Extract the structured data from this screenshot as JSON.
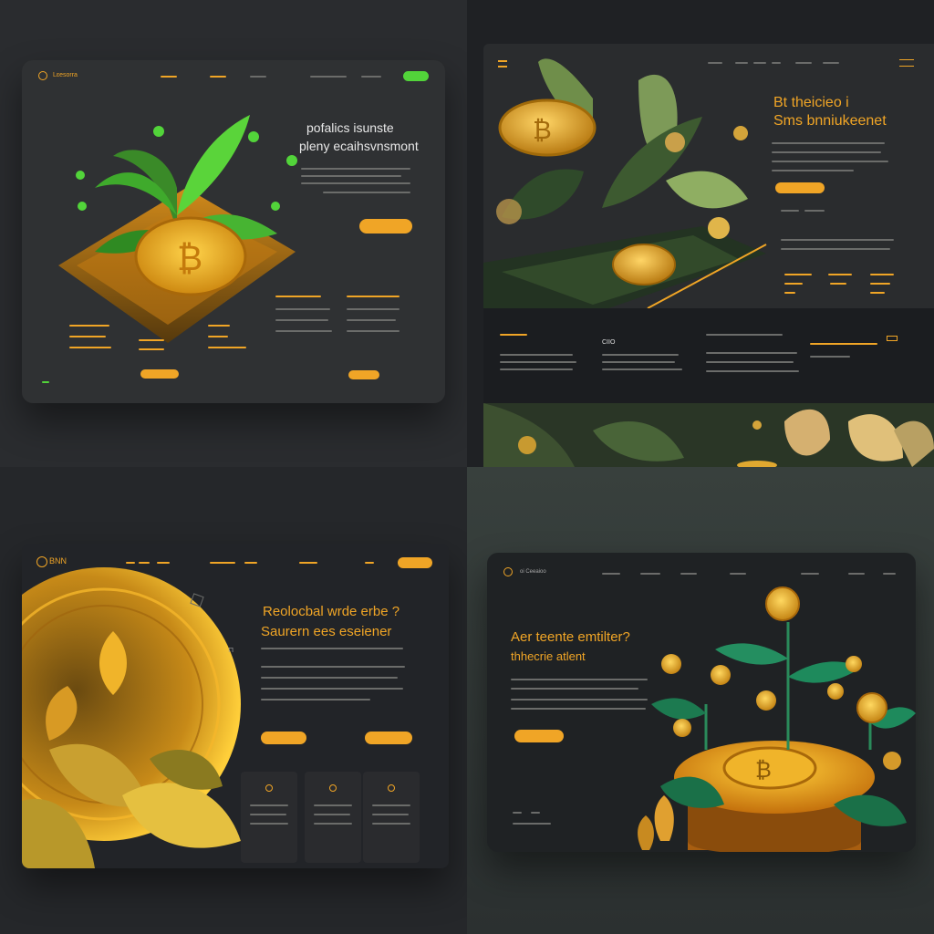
{
  "panels": [
    {
      "id": "q1",
      "brand": "Lɛesorra",
      "hero_title_line1": "pofalics isunste",
      "hero_title_line2": "pleny ecaihsvnsmont",
      "cta_label": "",
      "accent": "#52d43a"
    },
    {
      "id": "q2",
      "hero_title_line1": "Bt theicieo i",
      "hero_title_line2": "Sms bnniukeenet",
      "section_label": "CIIO",
      "accent": "#f0a526"
    },
    {
      "id": "q3",
      "brand": "BNN",
      "hero_title_line1": "Reolocbal wrde erbe ?",
      "hero_title_line2": "Saurern ees eseiener",
      "accent": "#f0a526"
    },
    {
      "id": "q4",
      "brand": "oi Ceeaioo",
      "hero_title_line1": "Aer teente emtilter?",
      "hero_title_line2": "thhecrie atlent",
      "accent": "#f0a526"
    }
  ]
}
